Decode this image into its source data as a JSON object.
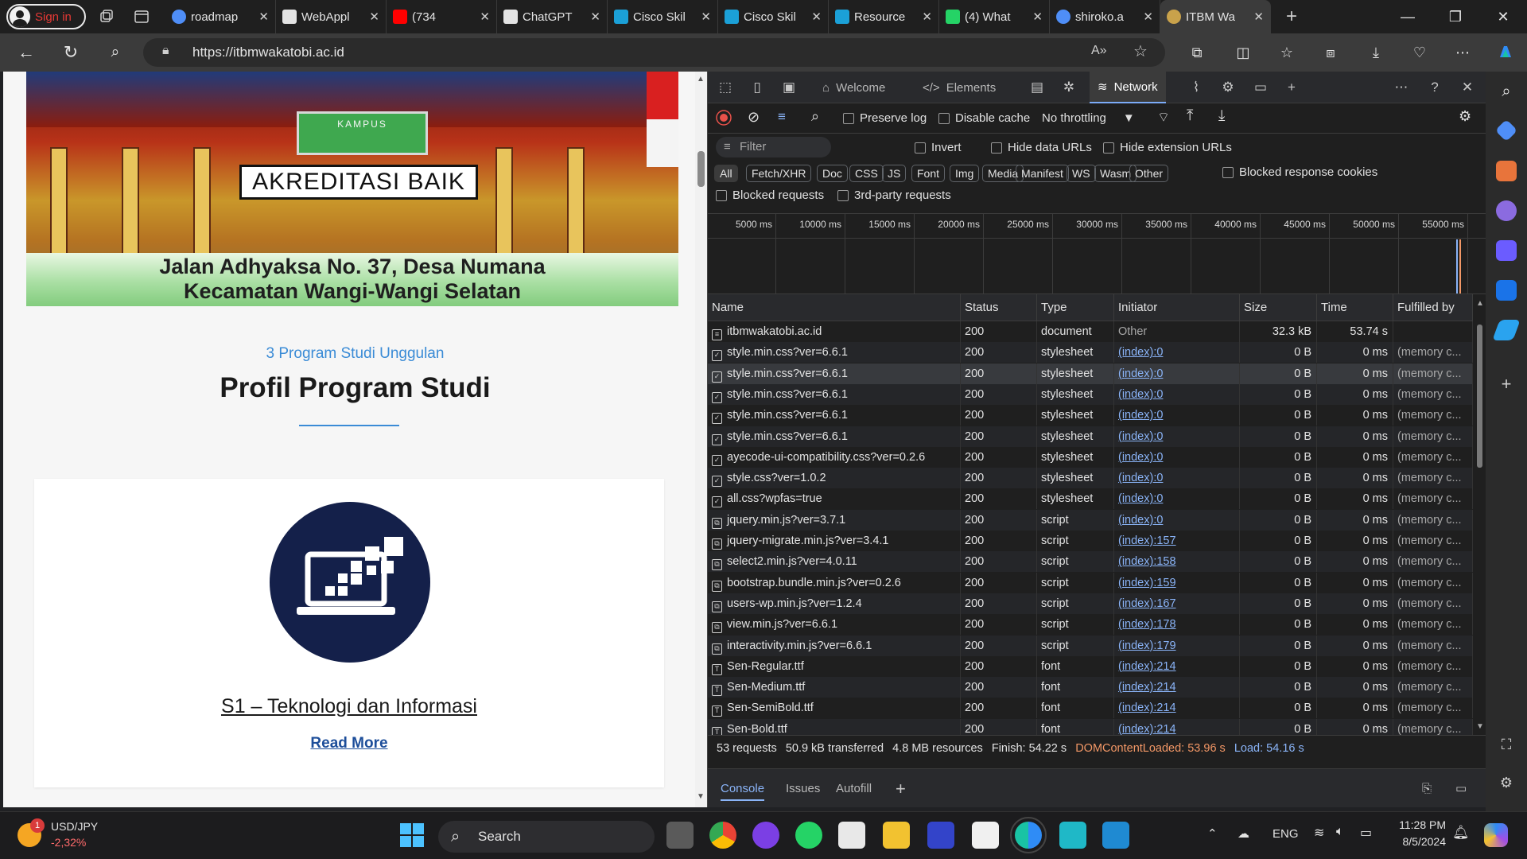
{
  "browser": {
    "profile_label": "Sign in",
    "tabs": [
      {
        "title": "roadmap",
        "icon": "search-icon",
        "color": "#4f8ef7"
      },
      {
        "title": "WebAppl",
        "icon": "github-icon",
        "color": "#e3e3e3"
      },
      {
        "title": "(734",
        "icon": "youtube-icon",
        "color": "#ff0000"
      },
      {
        "title": "ChatGPT",
        "icon": "chatgpt-icon",
        "color": "#e3e3e3"
      },
      {
        "title": "Cisco Skil",
        "icon": "cisco-icon",
        "color": "#1ba0d7"
      },
      {
        "title": "Cisco Skil",
        "icon": "cisco-icon",
        "color": "#1ba0d7"
      },
      {
        "title": "Resource",
        "icon": "cisco-icon",
        "color": "#1ba0d7"
      },
      {
        "title": "(4) What",
        "icon": "whatsapp-icon",
        "color": "#25d366"
      },
      {
        "title": "shiroko.a",
        "icon": "search-icon",
        "color": "#4f8ef7"
      },
      {
        "title": "ITBM Wa",
        "icon": "loading-icon",
        "color": "#c9a24b",
        "active": true
      }
    ],
    "url": "https://itbmwakatobi.ac.id"
  },
  "page": {
    "hero_badge": "AKREDITASI BAIK",
    "hero_sign": "KAMPUS",
    "hero_address_1": "Jalan Adhyaksa No. 37, Desa Numana",
    "hero_address_2": "Kecamatan Wangi-Wangi Selatan",
    "section_subtitle": "3 Program Studi Unggulan",
    "section_title": "Profil Program Studi",
    "card_title": "S1 – Teknologi dan Informasi",
    "card_link": "Read More"
  },
  "devtools": {
    "tabs": [
      "Welcome",
      "Elements",
      "Network"
    ],
    "active_tab": "Network",
    "toolbar": {
      "preserve_log": "Preserve log",
      "disable_cache": "Disable cache",
      "throttling": "No throttling"
    },
    "filter_placeholder": "Filter",
    "invert": "Invert",
    "hide_data_urls": "Hide data URLs",
    "hide_extension_urls": "Hide extension URLs",
    "type_chips": [
      "All",
      "Fetch/XHR",
      "Doc",
      "CSS",
      "JS",
      "Font",
      "Img",
      "Media",
      "Manifest",
      "WS",
      "Wasm",
      "Other"
    ],
    "blocked_response_cookies": "Blocked response cookies",
    "blocked_requests": "Blocked requests",
    "third_party_requests": "3rd-party requests",
    "timeline_ticks": [
      "5000 ms",
      "10000 ms",
      "15000 ms",
      "20000 ms",
      "25000 ms",
      "30000 ms",
      "35000 ms",
      "40000 ms",
      "45000 ms",
      "50000 ms",
      "55000 ms"
    ],
    "columns": [
      "Name",
      "Status",
      "Type",
      "Initiator",
      "Size",
      "Time",
      "Fulfilled by"
    ],
    "rows": [
      {
        "name": "itbmwakatobi.ac.id",
        "kind": "doc",
        "status": "200",
        "type": "document",
        "initiator": "Other",
        "size": "32.3 kB",
        "time": "53.74 s",
        "fulfilled": ""
      },
      {
        "name": "style.min.css?ver=6.6.1",
        "kind": "css",
        "status": "200",
        "type": "stylesheet",
        "initiator": "(index):0",
        "size": "0 B",
        "time": "0 ms",
        "fulfilled": "(memory c..."
      },
      {
        "name": "style.min.css?ver=6.6.1",
        "kind": "css",
        "status": "200",
        "type": "stylesheet",
        "initiator": "(index):0",
        "size": "0 B",
        "time": "0 ms",
        "fulfilled": "(memory c..."
      },
      {
        "name": "style.min.css?ver=6.6.1",
        "kind": "css",
        "status": "200",
        "type": "stylesheet",
        "initiator": "(index):0",
        "size": "0 B",
        "time": "0 ms",
        "fulfilled": "(memory c..."
      },
      {
        "name": "style.min.css?ver=6.6.1",
        "kind": "css",
        "status": "200",
        "type": "stylesheet",
        "initiator": "(index):0",
        "size": "0 B",
        "time": "0 ms",
        "fulfilled": "(memory c..."
      },
      {
        "name": "style.min.css?ver=6.6.1",
        "kind": "css",
        "status": "200",
        "type": "stylesheet",
        "initiator": "(index):0",
        "size": "0 B",
        "time": "0 ms",
        "fulfilled": "(memory c..."
      },
      {
        "name": "ayecode-ui-compatibility.css?ver=0.2.6",
        "kind": "css",
        "status": "200",
        "type": "stylesheet",
        "initiator": "(index):0",
        "size": "0 B",
        "time": "0 ms",
        "fulfilled": "(memory c..."
      },
      {
        "name": "style.css?ver=1.0.2",
        "kind": "css",
        "status": "200",
        "type": "stylesheet",
        "initiator": "(index):0",
        "size": "0 B",
        "time": "0 ms",
        "fulfilled": "(memory c..."
      },
      {
        "name": "all.css?wpfas=true",
        "kind": "css",
        "status": "200",
        "type": "stylesheet",
        "initiator": "(index):0",
        "size": "0 B",
        "time": "0 ms",
        "fulfilled": "(memory c..."
      },
      {
        "name": "jquery.min.js?ver=3.7.1",
        "kind": "js",
        "status": "200",
        "type": "script",
        "initiator": "(index):0",
        "size": "0 B",
        "time": "0 ms",
        "fulfilled": "(memory c..."
      },
      {
        "name": "jquery-migrate.min.js?ver=3.4.1",
        "kind": "js",
        "status": "200",
        "type": "script",
        "initiator": "(index):157",
        "size": "0 B",
        "time": "0 ms",
        "fulfilled": "(memory c..."
      },
      {
        "name": "select2.min.js?ver=4.0.11",
        "kind": "js",
        "status": "200",
        "type": "script",
        "initiator": "(index):158",
        "size": "0 B",
        "time": "0 ms",
        "fulfilled": "(memory c..."
      },
      {
        "name": "bootstrap.bundle.min.js?ver=0.2.6",
        "kind": "js",
        "status": "200",
        "type": "script",
        "initiator": "(index):159",
        "size": "0 B",
        "time": "0 ms",
        "fulfilled": "(memory c..."
      },
      {
        "name": "users-wp.min.js?ver=1.2.4",
        "kind": "js",
        "status": "200",
        "type": "script",
        "initiator": "(index):167",
        "size": "0 B",
        "time": "0 ms",
        "fulfilled": "(memory c..."
      },
      {
        "name": "view.min.js?ver=6.6.1",
        "kind": "js",
        "status": "200",
        "type": "script",
        "initiator": "(index):178",
        "size": "0 B",
        "time": "0 ms",
        "fulfilled": "(memory c..."
      },
      {
        "name": "interactivity.min.js?ver=6.6.1",
        "kind": "js",
        "status": "200",
        "type": "script",
        "initiator": "(index):179",
        "size": "0 B",
        "time": "0 ms",
        "fulfilled": "(memory c..."
      },
      {
        "name": "Sen-Regular.ttf",
        "kind": "font",
        "status": "200",
        "type": "font",
        "initiator": "(index):214",
        "size": "0 B",
        "time": "0 ms",
        "fulfilled": "(memory c..."
      },
      {
        "name": "Sen-Medium.ttf",
        "kind": "font",
        "status": "200",
        "type": "font",
        "initiator": "(index):214",
        "size": "0 B",
        "time": "0 ms",
        "fulfilled": "(memory c..."
      },
      {
        "name": "Sen-SemiBold.ttf",
        "kind": "font",
        "status": "200",
        "type": "font",
        "initiator": "(index):214",
        "size": "0 B",
        "time": "0 ms",
        "fulfilled": "(memory c..."
      },
      {
        "name": "Sen-Bold.ttf",
        "kind": "font",
        "status": "200",
        "type": "font",
        "initiator": "(index):214",
        "size": "0 B",
        "time": "0 ms",
        "fulfilled": "(memory c..."
      }
    ],
    "summary": {
      "requests": "53 requests",
      "transferred": "50.9 kB transferred",
      "resources": "4.8 MB resources",
      "finish": "Finish: 54.22 s",
      "dom_content_loaded": "DOMContentLoaded: 53.96 s",
      "load": "Load: 54.16 s"
    },
    "drawer_tabs": [
      "Console",
      "Issues",
      "Autofill"
    ]
  },
  "taskbar": {
    "widget_badge": "1",
    "widget_title": "USD/JPY",
    "widget_value": "-2,32%",
    "search_label": "Search",
    "lang": "ENG",
    "time": "11:28 PM",
    "date": "8/5/2024"
  },
  "colors": {
    "accent_blue": "#8ab4f8",
    "record_red": "#e8514a",
    "dcl_orange": "#f29766",
    "load_blue": "#8ab4f8"
  }
}
